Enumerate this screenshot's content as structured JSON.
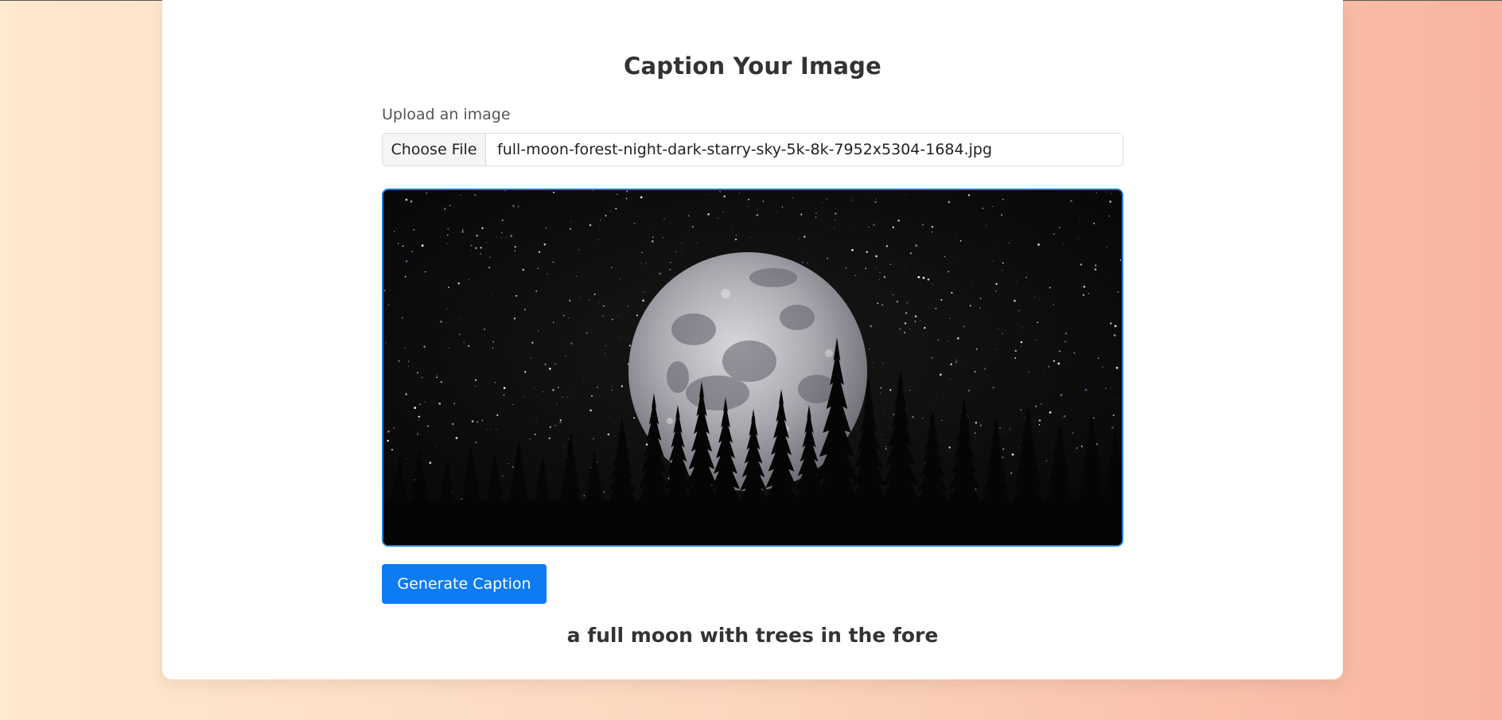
{
  "page": {
    "title": "Caption Your Image"
  },
  "upload": {
    "label": "Upload an image",
    "choose_button": "Choose File",
    "file_name": "full-moon-forest-night-dark-starry-sky-5k-8k-7952x5304-1684.jpg"
  },
  "preview": {
    "image_icon": "moon-forest-night-image"
  },
  "actions": {
    "generate_label": "Generate Caption"
  },
  "result": {
    "caption": "a full moon with trees in the fore"
  },
  "colors": {
    "accent": "#0d7bf2",
    "preview_border": "#1a7ad6",
    "background_start": "#ffe9cf",
    "background_end": "#f8b4a0"
  }
}
